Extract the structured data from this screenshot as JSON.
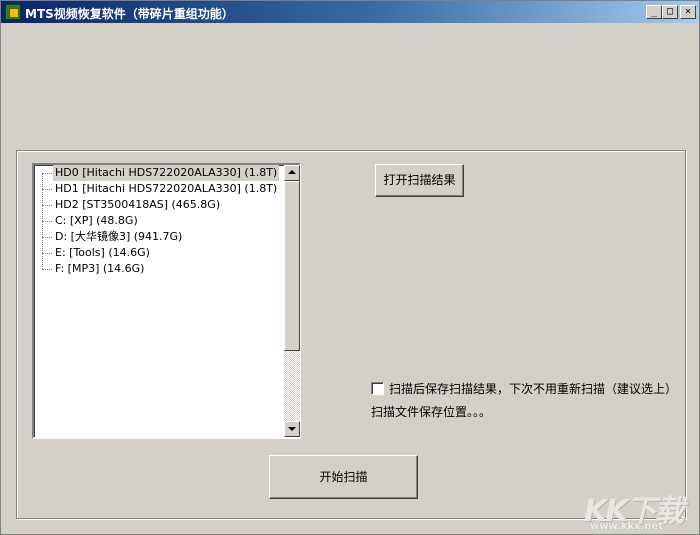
{
  "window": {
    "title": "MTS视频恢复软件（带碎片重组功能）",
    "controls": {
      "minimize": "_",
      "maximize": "□",
      "close": "×"
    }
  },
  "tree": {
    "items": [
      {
        "label": "HD0   [Hitachi HDS722020ALA330]  (1.8T)",
        "selected": true
      },
      {
        "label": "HD1   [Hitachi HDS722020ALA330]  (1.8T)",
        "selected": false
      },
      {
        "label": "HD2   [ST3500418AS]  (465.8G)",
        "selected": false
      },
      {
        "label": "C:   [XP]  (48.8G)",
        "selected": false
      },
      {
        "label": "D:   [大华镜像3]  (941.7G)",
        "selected": false
      },
      {
        "label": "E:   [Tools]  (14.6G)",
        "selected": false
      },
      {
        "label": "F:   [MP3]  (14.6G)",
        "selected": false
      }
    ]
  },
  "buttons": {
    "open_scan_result": "打开扫描结果",
    "start_scan": "开始扫描"
  },
  "options": {
    "save_scan_result_label": "扫描后保存扫描结果，下次不用重新扫描（建议选上）",
    "save_scan_result_checked": false,
    "save_location_text": "扫描文件保存位置。。。"
  },
  "watermark": {
    "logo": "KK下载",
    "url": "www.kkx.net"
  }
}
